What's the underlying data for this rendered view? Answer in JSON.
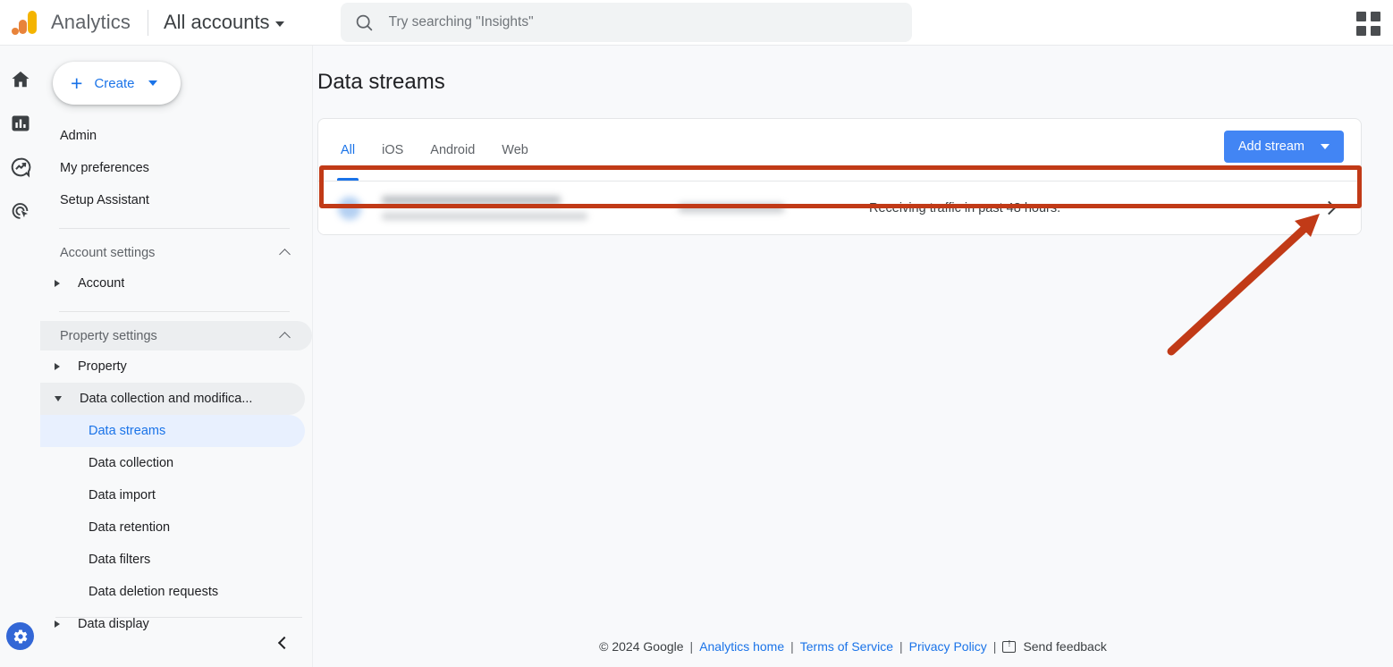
{
  "topbar": {
    "brand": "Analytics",
    "account_switcher": "All accounts",
    "search_placeholder": "Try searching \"Insights\"",
    "logo_colors": {
      "tall_bar": "#f4b400",
      "mid_bar": "#e8833a",
      "dot": "#e8833a"
    },
    "apps_icon": "apps-grid-icon"
  },
  "rail": {
    "items": [
      {
        "name": "home-icon",
        "label": "Home"
      },
      {
        "name": "reports-icon",
        "label": "Reports"
      },
      {
        "name": "explore-icon",
        "label": "Explore"
      },
      {
        "name": "advertising-icon",
        "label": "Advertising"
      }
    ],
    "admin": {
      "name": "gear-icon",
      "label": "Admin",
      "active": true,
      "color": "#3367d6"
    }
  },
  "sidebar": {
    "create_button": {
      "label": "Create",
      "plus": "+",
      "caret": "chevron-down-icon"
    },
    "top_links": [
      "Admin",
      "My preferences",
      "Setup Assistant"
    ],
    "account_settings": {
      "label": "Account settings",
      "expanded": true
    },
    "account_item": "Account",
    "property_settings": {
      "label": "Property settings",
      "expanded": true
    },
    "property_item": "Property",
    "data_collection_group": "Data collection and modifica...",
    "data_collection_children": [
      "Data streams",
      "Data collection",
      "Data import",
      "Data retention",
      "Data filters",
      "Data deletion requests"
    ],
    "active_child": "Data streams",
    "data_display_item": "Data display",
    "collapse_icon": "chevron-left-icon"
  },
  "main": {
    "page_title": "Data streams",
    "tabs": [
      {
        "label": "All",
        "active": true
      },
      {
        "label": "iOS",
        "active": false
      },
      {
        "label": "Android",
        "active": false
      },
      {
        "label": "Web",
        "active": false
      }
    ],
    "add_stream_button": {
      "label": "Add stream",
      "caret": "chevron-down-icon",
      "color": "#4285f4"
    },
    "streams": [
      {
        "name_redacted": true,
        "url_redacted": true,
        "id_redacted": true,
        "status": "Receiving traffic in past 48 hours.",
        "chevron": "chevron-right-icon"
      }
    ]
  },
  "footer": {
    "copyright": "© 2024 Google",
    "links": [
      "Analytics home",
      "Terms of Service",
      "Privacy Policy"
    ],
    "feedback": "Send feedback",
    "separator": "|"
  },
  "annotations": {
    "highlight_box": {
      "color": "#c13a17",
      "target": "data-stream-row"
    },
    "arrow": {
      "color": "#c13a17",
      "points_to": "data-stream-row-chevron"
    }
  }
}
